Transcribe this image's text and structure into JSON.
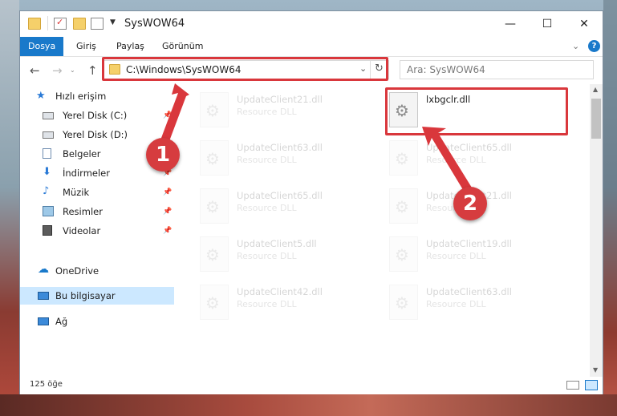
{
  "window": {
    "title": "SysWOW64",
    "buttons": {
      "minimize": "—",
      "maximize": "☐",
      "close": "✕"
    }
  },
  "ribbon": {
    "tabs": [
      "Dosya",
      "Giriş",
      "Paylaş",
      "Görünüm"
    ],
    "collapse_icon": "chevron-down-icon",
    "help_icon": "help-icon"
  },
  "nav": {
    "back": "←",
    "forward": "→",
    "up": "↑",
    "address": "C:\\Windows\\SysWOW64",
    "search_placeholder": "Ara: SysWOW64"
  },
  "sidebar": {
    "items": [
      {
        "label": "Hızlı erişim",
        "icon": "star-icon"
      },
      {
        "label": "Yerel Disk (C:)",
        "icon": "drive-icon"
      },
      {
        "label": "Yerel Disk (D:)",
        "icon": "drive-icon"
      },
      {
        "label": "Belgeler",
        "icon": "documents-icon"
      },
      {
        "label": "İndirmeler",
        "icon": "download-icon"
      },
      {
        "label": "Müzik",
        "icon": "music-icon"
      },
      {
        "label": "Resimler",
        "icon": "pictures-icon"
      },
      {
        "label": "Videolar",
        "icon": "videos-icon"
      },
      {
        "label": "OneDrive",
        "icon": "cloud-icon"
      },
      {
        "label": "Bu bilgisayar",
        "icon": "computer-icon"
      },
      {
        "label": "Ağ",
        "icon": "network-icon"
      }
    ]
  },
  "files": [
    {
      "name": "UpdateClient21.dll",
      "type": "Resource DLL"
    },
    {
      "name": "lxbgclr.dll",
      "type": ""
    },
    {
      "name": "UpdateClient63.dll",
      "type": "Resource DLL"
    },
    {
      "name": "UpdateClient65.dll",
      "type": "Resource DLL"
    },
    {
      "name": "UpdateClient65.dll",
      "type": "Resource DLL"
    },
    {
      "name": "UpdateClient21.dll",
      "type": "Resource DLL"
    },
    {
      "name": "UpdateClient5.dll",
      "type": "Resource DLL"
    },
    {
      "name": "UpdateClient19.dll",
      "type": "Resource DLL"
    },
    {
      "name": "UpdateClient42.dll",
      "type": "Resource DLL"
    },
    {
      "name": "UpdateClient63.dll",
      "type": "Resource DLL"
    }
  ],
  "status": {
    "count": "125 öğe"
  },
  "annotations": {
    "badge1": "1",
    "badge2": "2",
    "color": "#d9373c"
  }
}
